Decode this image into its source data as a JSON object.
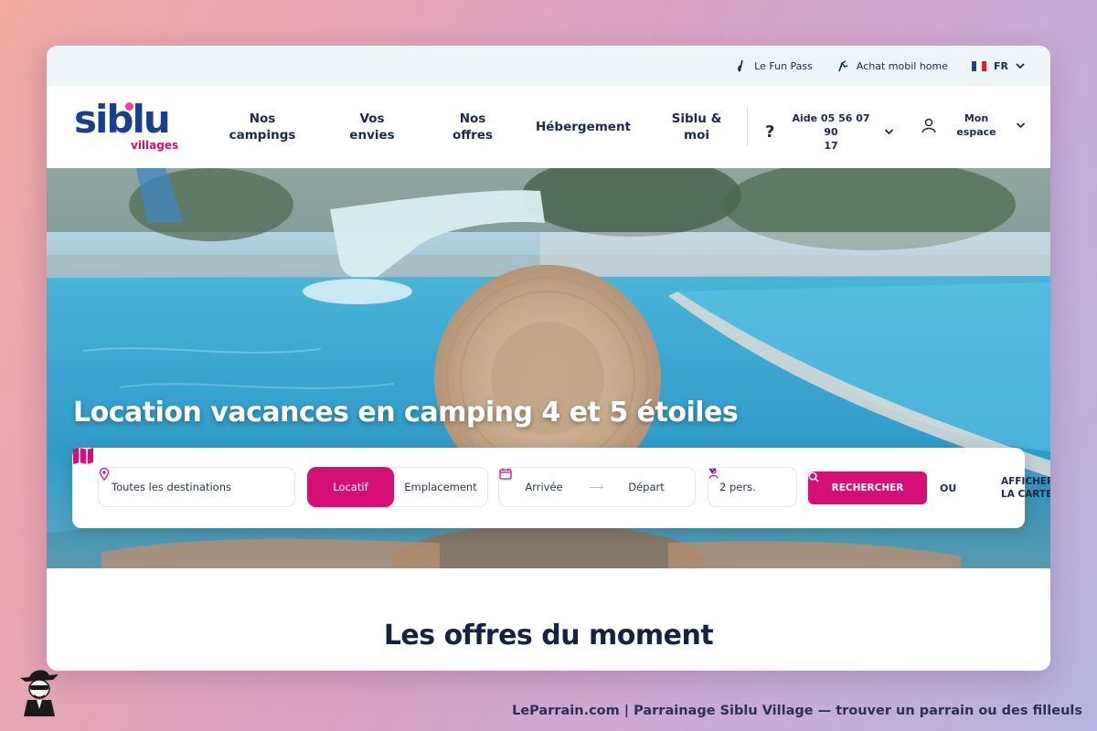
{
  "topbar": {
    "fun_pass": "Le Fun Pass",
    "achat": "Achat mobil home",
    "lang": "FR",
    "icons": [
      "fun-pass-icon",
      "mobil-home-icon",
      "flag-fr-icon",
      "chevron-down-icon"
    ]
  },
  "logo": {
    "word": "siblu",
    "sub": "villages"
  },
  "nav": {
    "items": [
      {
        "label": "Nos\ncampings"
      },
      {
        "label": "Vos\nenvies"
      },
      {
        "label": "Nos\noffres"
      },
      {
        "label": "Hébergement"
      },
      {
        "label": "Siblu &\nmoi"
      }
    ],
    "help": "Aide 05 56 07 90\n17",
    "account": "Mon\nespace"
  },
  "hero": {
    "title": "Location vacances en camping 4 et 5 étoiles"
  },
  "search": {
    "destination_placeholder": "Toutes les destinations",
    "type_active": "Locatif",
    "type_other": "Emplacement",
    "arrival": "Arrivée",
    "departure": "Départ",
    "persons": "2 pers.",
    "search_button": "RECHERCHER",
    "or": "OU",
    "map_label": "AFFICHER\nLA CARTE"
  },
  "offers": {
    "title": "Les offres du moment"
  },
  "footer": {
    "caption": "LeParrain.com | Parrainage Siblu Village — trouver un parrain ou des filleuls"
  },
  "colors": {
    "brand_pink": "#d60f76",
    "brand_blue": "#1a3f8f",
    "navy": "#1b2a4a"
  }
}
